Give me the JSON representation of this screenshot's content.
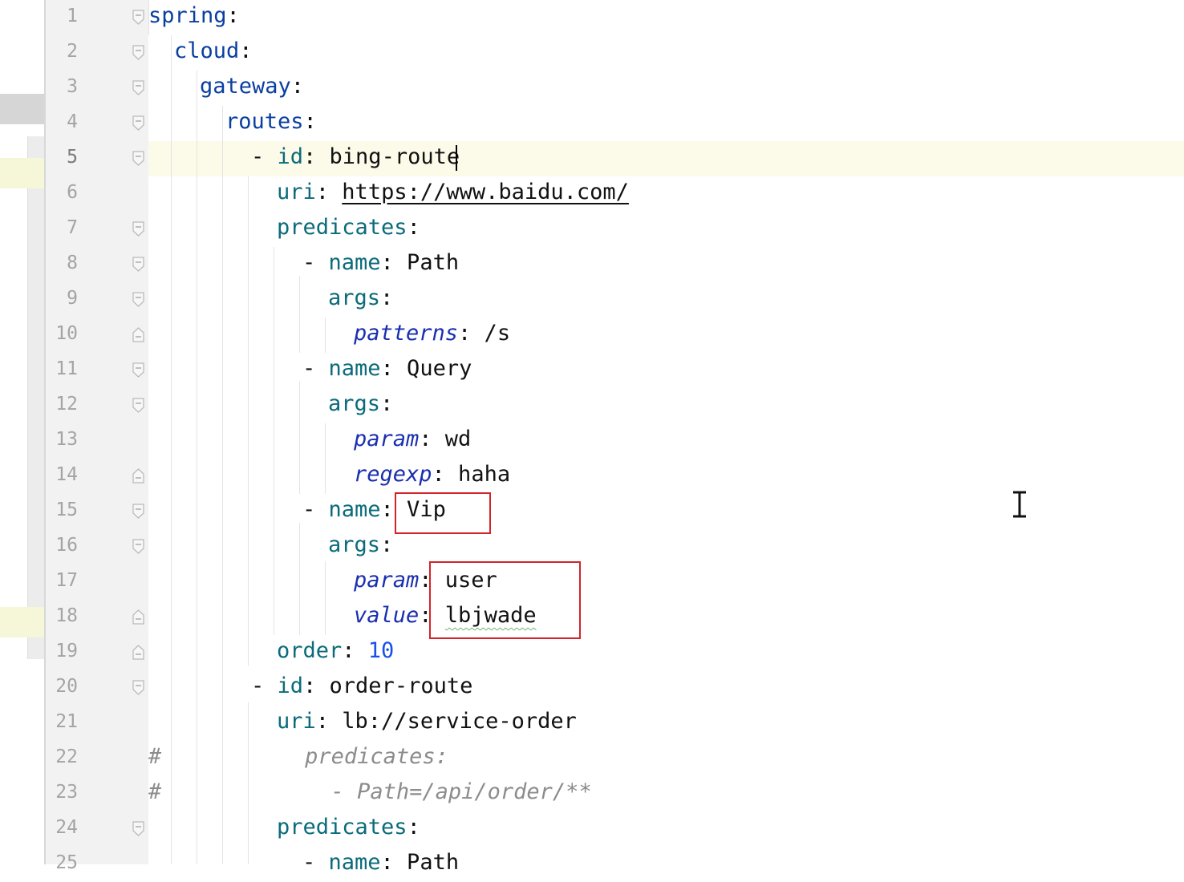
{
  "editor": {
    "current_line": 5,
    "lines": [
      {
        "n": "1",
        "indent": 0,
        "fold": "top",
        "parts": [
          {
            "t": "spring",
            "c": "t-key"
          },
          {
            "t": ":",
            "c": "t-val"
          }
        ]
      },
      {
        "n": "2",
        "indent": 1,
        "fold": "top",
        "parts": [
          {
            "t": "cloud",
            "c": "t-key"
          },
          {
            "t": ":",
            "c": "t-val"
          }
        ]
      },
      {
        "n": "3",
        "indent": 2,
        "fold": "top",
        "parts": [
          {
            "t": "gateway",
            "c": "t-key"
          },
          {
            "t": ":",
            "c": "t-val"
          }
        ]
      },
      {
        "n": "4",
        "indent": 3,
        "fold": "top",
        "parts": [
          {
            "t": "routes",
            "c": "t-key"
          },
          {
            "t": ":",
            "c": "t-val"
          }
        ]
      },
      {
        "n": "5",
        "indent": 4,
        "fold": "top",
        "parts": [
          {
            "t": "- ",
            "c": "t-val"
          },
          {
            "t": "id",
            "c": "t-key2"
          },
          {
            "t": ": bing-route",
            "c": "t-val"
          }
        ]
      },
      {
        "n": "6",
        "indent": 5,
        "fold": "",
        "parts": [
          {
            "t": "uri",
            "c": "t-key2"
          },
          {
            "t": ": ",
            "c": "t-val"
          },
          {
            "t": "https://www.baidu.com/",
            "c": "t-url"
          }
        ]
      },
      {
        "n": "7",
        "indent": 5,
        "fold": "top",
        "parts": [
          {
            "t": "predicates",
            "c": "t-key2"
          },
          {
            "t": ":",
            "c": "t-val"
          }
        ]
      },
      {
        "n": "8",
        "indent": 6,
        "fold": "top",
        "parts": [
          {
            "t": "- ",
            "c": "t-val"
          },
          {
            "t": "name",
            "c": "t-key2"
          },
          {
            "t": ": Path",
            "c": "t-val"
          }
        ]
      },
      {
        "n": "9",
        "indent": 7,
        "fold": "top",
        "parts": [
          {
            "t": "args",
            "c": "t-key2"
          },
          {
            "t": ":",
            "c": "t-val"
          }
        ]
      },
      {
        "n": "10",
        "indent": 8,
        "fold": "end",
        "parts": [
          {
            "t": "patterns",
            "c": "t-keyi"
          },
          {
            "t": ": /s",
            "c": "t-val"
          }
        ]
      },
      {
        "n": "11",
        "indent": 6,
        "fold": "top",
        "parts": [
          {
            "t": "- ",
            "c": "t-val"
          },
          {
            "t": "name",
            "c": "t-key2"
          },
          {
            "t": ": Query",
            "c": "t-val"
          }
        ]
      },
      {
        "n": "12",
        "indent": 7,
        "fold": "top",
        "parts": [
          {
            "t": "args",
            "c": "t-key2"
          },
          {
            "t": ":",
            "c": "t-val"
          }
        ]
      },
      {
        "n": "13",
        "indent": 8,
        "fold": "",
        "parts": [
          {
            "t": "param",
            "c": "t-keyi"
          },
          {
            "t": ": wd",
            "c": "t-val"
          }
        ]
      },
      {
        "n": "14",
        "indent": 8,
        "fold": "end",
        "parts": [
          {
            "t": "regexp",
            "c": "t-keyi"
          },
          {
            "t": ": haha",
            "c": "t-val"
          }
        ]
      },
      {
        "n": "15",
        "indent": 6,
        "fold": "top",
        "parts": [
          {
            "t": "- ",
            "c": "t-val"
          },
          {
            "t": "name",
            "c": "t-key2"
          },
          {
            "t": ": Vip",
            "c": "t-val"
          }
        ]
      },
      {
        "n": "16",
        "indent": 7,
        "fold": "top",
        "parts": [
          {
            "t": "args",
            "c": "t-key2"
          },
          {
            "t": ":",
            "c": "t-val"
          }
        ]
      },
      {
        "n": "17",
        "indent": 8,
        "fold": "",
        "parts": [
          {
            "t": "param",
            "c": "t-keyi"
          },
          {
            "t": ": user",
            "c": "t-val"
          }
        ]
      },
      {
        "n": "18",
        "indent": 8,
        "fold": "end",
        "parts": [
          {
            "t": "value",
            "c": "t-keyi"
          },
          {
            "t": ": ",
            "c": "t-val"
          },
          {
            "t": "lbjwade",
            "c": "t-val squig"
          }
        ]
      },
      {
        "n": "19",
        "indent": 5,
        "fold": "end",
        "parts": [
          {
            "t": "order",
            "c": "t-key2"
          },
          {
            "t": ": ",
            "c": "t-val"
          },
          {
            "t": "10",
            "c": "t-num"
          }
        ]
      },
      {
        "n": "20",
        "indent": 4,
        "fold": "top",
        "parts": [
          {
            "t": "- ",
            "c": "t-val"
          },
          {
            "t": "id",
            "c": "t-key2"
          },
          {
            "t": ": order-route",
            "c": "t-val"
          }
        ]
      },
      {
        "n": "21",
        "indent": 5,
        "fold": "",
        "parts": [
          {
            "t": "uri",
            "c": "t-key2"
          },
          {
            "t": ": lb://service-order",
            "c": "t-val"
          }
        ]
      },
      {
        "n": "22",
        "indent": 0,
        "fold": "",
        "parts": [
          {
            "t": "#",
            "c": "t-hash"
          },
          {
            "t": "           predicates:",
            "c": "t-com"
          }
        ]
      },
      {
        "n": "23",
        "indent": 0,
        "fold": "",
        "parts": [
          {
            "t": "#",
            "c": "t-hash"
          },
          {
            "t": "             - Path=/api/order/**",
            "c": "t-com"
          }
        ]
      },
      {
        "n": "24",
        "indent": 5,
        "fold": "top",
        "parts": [
          {
            "t": "predicates",
            "c": "t-key2"
          },
          {
            "t": ":",
            "c": "t-val"
          }
        ]
      },
      {
        "n": "25",
        "indent": 6,
        "fold": "",
        "parts": [
          {
            "t": "- ",
            "c": "t-val"
          },
          {
            "t": "name",
            "c": "t-key2"
          },
          {
            "t": ": Path",
            "c": "t-val"
          }
        ]
      }
    ]
  },
  "annotations": [
    "vip-name-box",
    "args-values-box"
  ],
  "colors": {
    "accent_red": "#d3232a",
    "key_blue": "#0a3fa0",
    "key_teal": "#0a6b7a",
    "number": "#1750eb"
  }
}
